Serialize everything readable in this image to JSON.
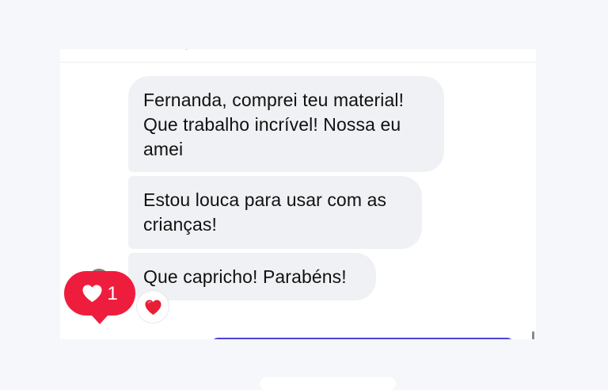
{
  "messages": [
    {
      "text": "Fernanda, comprei teu material! Que trabalho incrível! Nossa eu amei"
    },
    {
      "text": "Estou louca para usar com as crianças!"
    },
    {
      "text": "Que capricho! Parabéns!",
      "reaction": "heart"
    }
  ],
  "like_badge": {
    "icon": "heart-icon",
    "count": "1",
    "color": "#ef1d3d"
  },
  "colors": {
    "bubble": "#f0f1f4",
    "composer_border": "#4c43d8",
    "background": "#f6f7fb"
  }
}
